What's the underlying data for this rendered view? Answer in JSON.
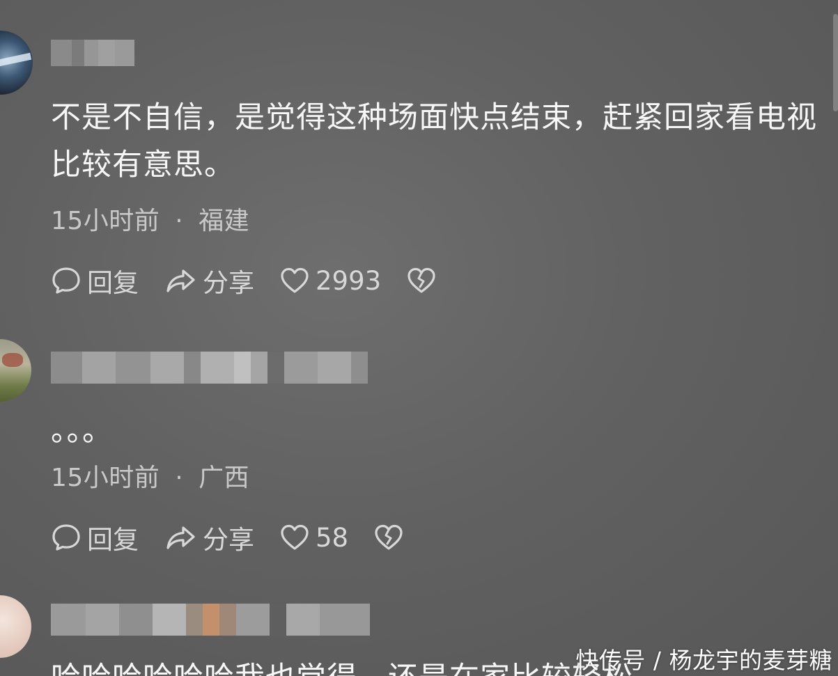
{
  "comments": [
    {
      "text": "不是不自信，是觉得这种场面快点结束，赶紧回家看电视比较有意思。",
      "time": "15小时前",
      "location": "福建",
      "reply_label": "回复",
      "share_label": "分享",
      "likes": "2993"
    },
    {
      "text": "。。。",
      "time": "15小时前",
      "location": "广西",
      "reply_label": "回复",
      "share_label": "分享",
      "likes": "58"
    },
    {
      "text": "哈哈哈哈哈哈我也觉得，还是在家比较轻松"
    }
  ],
  "meta_separator": "·",
  "icons": {
    "reply": "reply-bubble-icon",
    "share": "share-arrow-icon",
    "like": "heart-icon",
    "dislike": "broken-heart-icon"
  },
  "watermark": "快传号 / 杨龙宇的麦芽糖"
}
